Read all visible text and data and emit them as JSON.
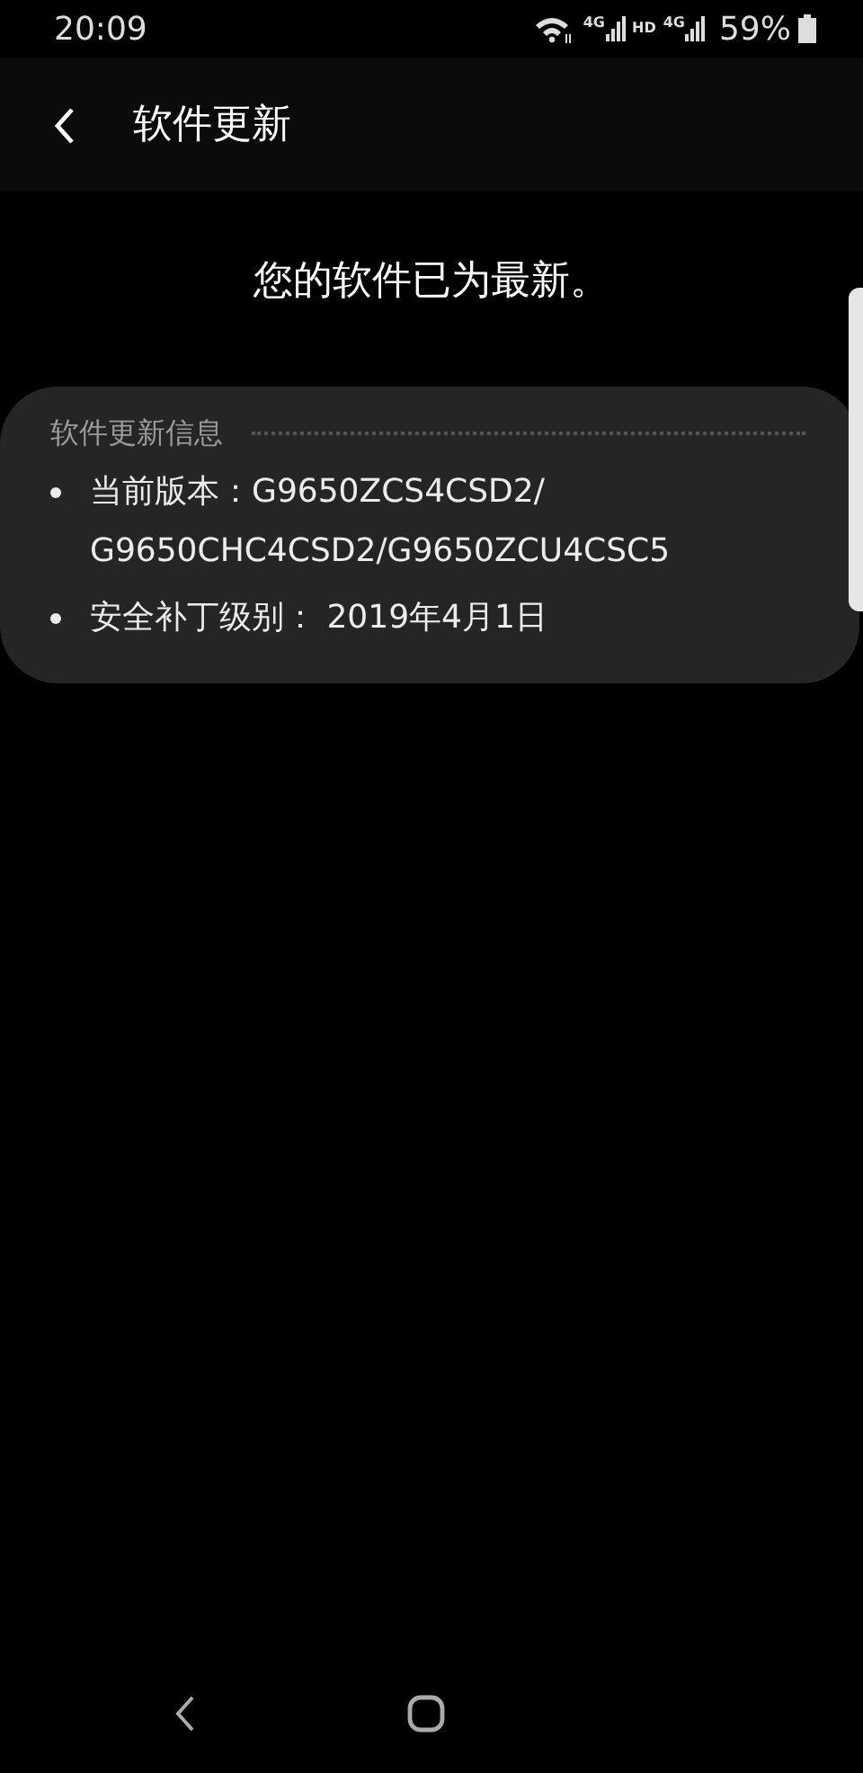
{
  "status_bar": {
    "time": "20:09",
    "network_labels": [
      "4G",
      "HD",
      "4G"
    ],
    "battery": "59%"
  },
  "header": {
    "title": "软件更新"
  },
  "message": "您的软件已为最新。",
  "info_card": {
    "title": "软件更新信息",
    "items": [
      {
        "lines": [
          "当前版本：G9650ZCS4CSD2/",
          "G9650CHC4CSD2/G9650ZCU4CSC5"
        ]
      },
      {
        "lines": [
          "安全补丁级别： 2019年4月1日"
        ]
      }
    ]
  }
}
